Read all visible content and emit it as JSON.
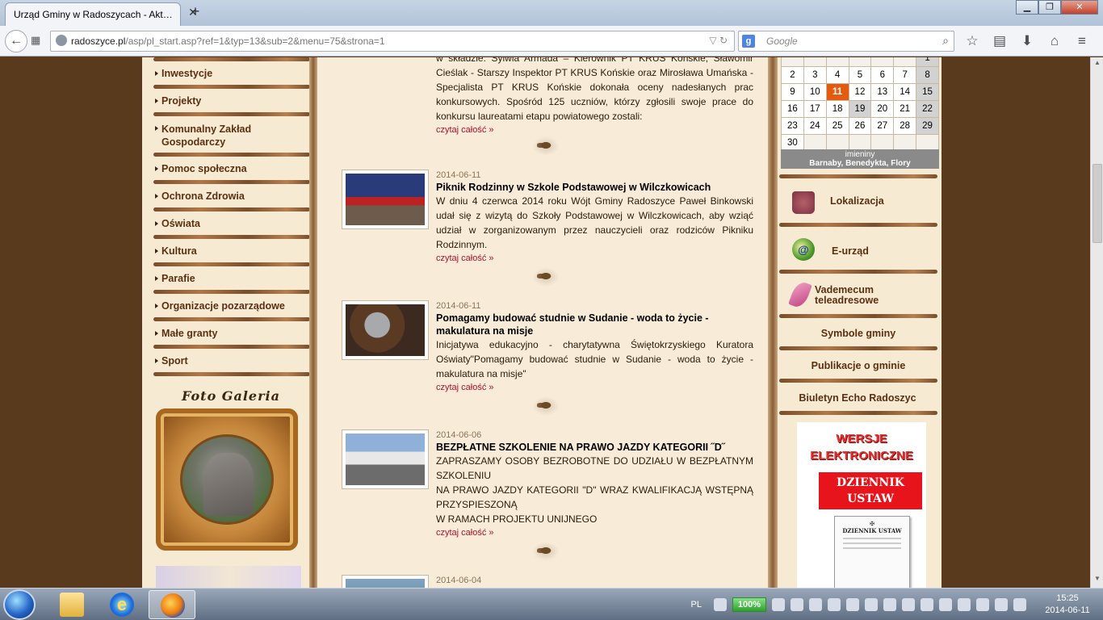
{
  "browser": {
    "tab_title": "Urząd Gminy w Radoszycach - Akt…",
    "tab_close": "✕",
    "new_tab": "+",
    "url_host": "radoszyce.pl",
    "url_path": "/asp/pl_start.asp?ref=1&typ=13&sub=2&menu=75&strona=1",
    "search_placeholder": "Google",
    "win_minimize": "▁",
    "win_maximize": "❐",
    "win_close": "✕"
  },
  "left_menu": {
    "items": [
      "Inwestycje",
      "Projekty",
      "Komunalny Zakład Gospodarczy",
      "Pomoc społeczna",
      "Ochrona Zdrowia",
      "Oświata",
      "Kultura",
      "Parafie",
      "Organizacje pozarządowe",
      "Małe granty",
      "Sport"
    ],
    "foto_galeria": "Foto Galeria"
  },
  "news": [
    {
      "date": "",
      "title": "",
      "text": "w składzie: Sylwia Armada – Kierownik PT KRUS Końskie, Sławomir Cieślak - Starszy Inspektor PT KRUS Końskie oraz Mirosława Umańska - Specjalista PT KRUS Końskie dokonała oceny nadesłanych prac konkursowych. Spośród 125 uczniów, którzy zgłosili swoje prace do konkursu laureatami etapu powiatowego zostali:",
      "more": "czytaj całość »"
    },
    {
      "date": "2014-06-11",
      "title": "Piknik Rodzinny w Szkole Podstawowej w Wilczkowicach",
      "text": "W dniu 4 czerwca 2014 roku Wójt Gminy Radoszyce Paweł Binkowski udał się z wizytą do Szkoły Podstawowej w Wilczkowicach, aby wziąć udział w zorganizowanym przez nauczycieli oraz rodziców Pikniku Rodzinnym.",
      "more": "czytaj całość »"
    },
    {
      "date": "2014-06-11",
      "title": "Pomagamy budować studnie w  Sudanie - woda to życie - makulatura na misje",
      "text": "Inicjatywa edukacyjno - charytatywna Świętokrzyskiego Kuratora Oświaty\"Pomagamy budować studnie w  Sudanie - woda to życie - makulatura na misje\"",
      "more": "czytaj całość »"
    },
    {
      "date": "2014-06-06",
      "title": "BEZPŁATNE SZKOLENIE NA PRAWO JAZDY KATEGORII ˝D˝",
      "text_lines": [
        "ZAPRASZAMY OSOBY BEZROBOTNE DO UDZIAŁU W BEZPŁATNYM SZKOLENIU",
        "NA PRAWO JAZDY KATEGORII \"D\" WRAZ KWALIFIKACJĄ WSTĘPNĄ PRZYSPIESZONĄ",
        "W RAMACH PROJEKTU UNIJNEGO"
      ],
      "more": "czytaj całość »"
    },
    {
      "date": "2014-06-04"
    }
  ],
  "calendar": {
    "rows": [
      [
        "",
        "",
        "",
        "",
        "",
        "",
        "1"
      ],
      [
        "2",
        "3",
        "4",
        "5",
        "6",
        "7",
        "8"
      ],
      [
        "9",
        "10",
        "11",
        "12",
        "13",
        "14",
        "15"
      ],
      [
        "16",
        "17",
        "18",
        "19",
        "20",
        "21",
        "22"
      ],
      [
        "23",
        "24",
        "25",
        "26",
        "27",
        "28",
        "29"
      ],
      [
        "30",
        "",
        "",
        "",
        "",
        "",
        ""
      ]
    ],
    "today": "11",
    "imieniny_label": "imieniny",
    "imieniny_names": "Barnaby, Benedykta, Flory"
  },
  "right_links": {
    "lokalizacja": "Lokalizacja",
    "eurzad": "E-urząd",
    "vademecum": "Vademecum teleadresowe",
    "symbole": "Symbole gminy",
    "publikacje": "Publikacje o gminie",
    "biuletyn": "Biuletyn Echo Radoszyc"
  },
  "banner": {
    "title_line1": "WERSJE",
    "title_line2": "ELEKTRONICZNE",
    "du_line1": "DZIENNIK",
    "du_line2": "USTAW",
    "doc_title": "DZIENNIK USTAW"
  },
  "taskbar": {
    "lang": "PL",
    "battery": "100%",
    "time": "15:25",
    "date": "2014-06-11"
  },
  "colors": {
    "accent_link": "#b01028",
    "menu_text": "#5a3010",
    "today": "#e45b10",
    "page_bg": "#5a3a1c"
  }
}
